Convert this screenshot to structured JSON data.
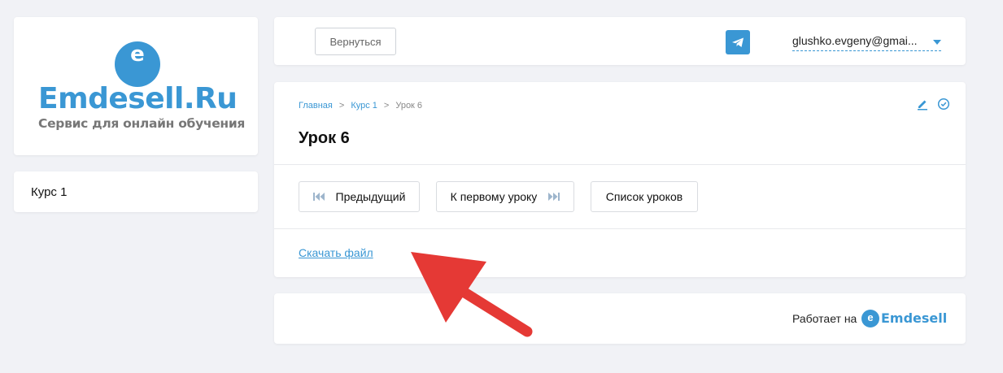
{
  "logo": {
    "badge_letter": "e",
    "brand": "Emdesell",
    "brand_suffix": ".Ru",
    "tagline": "Сервис для онлайн обучения"
  },
  "sidebar": {
    "course_label": "Курс 1"
  },
  "topbar": {
    "back_label": "Вернуться",
    "telegram_icon": "telegram-icon",
    "user_email": "glushko.evgeny@gmai..."
  },
  "lesson": {
    "breadcrumb": {
      "home": "Главная",
      "sep1": ">",
      "course": "Курс 1",
      "sep2": ">",
      "current": "Урок 6"
    },
    "title": "Урок 6",
    "nav": {
      "previous": "Предыдущий",
      "first": "К первому уроку",
      "list": "Список уроков"
    },
    "download_link": "Скачать файл"
  },
  "footer": {
    "powered_by": "Работает на",
    "badge_letter": "e",
    "brand": "Emdesell"
  },
  "colors": {
    "accent": "#3a97d4",
    "background": "#f1f2f6",
    "arrow": "#e53935"
  }
}
